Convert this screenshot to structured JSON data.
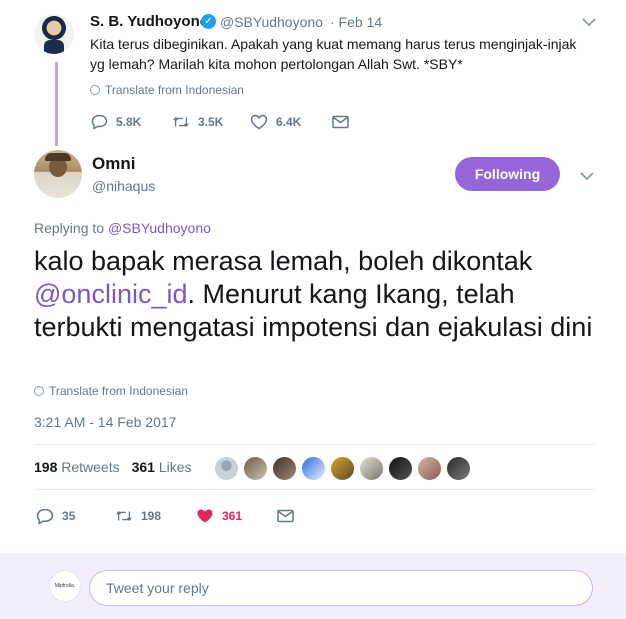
{
  "parent_tweet": {
    "name": "S. B. Yudhoyono",
    "handle": "@SBYudhoyono",
    "date": "· Feb 14",
    "text": "Kita terus dibeginikan. Apakah yang kuat memang harus terus menginjak-injak yg lemah? Marilah kita mohon pertolongan Allah Swt. *SBY*",
    "translate": "Translate from Indonesian",
    "replies": "5.8K",
    "retweets": "3.5K",
    "likes": "6.4K"
  },
  "main_tweet": {
    "name": "Omni",
    "handle": "@nihaqus",
    "follow_label": "Following",
    "replying_prefix": "Replying to",
    "replying_to": "@SBYudhoyono",
    "text_part1": "kalo bapak merasa lemah, boleh dikontak ",
    "mention": "@onclinic_id",
    "text_part2": ". Menurut kang Ikang, telah terbukti mengatasi impotensi dan ejakulasi dini",
    "translate": "Translate from Indonesian",
    "timestamp": "3:21 AM - 14 Feb 2017",
    "retweet_count": "198",
    "retweet_label": "Retweets",
    "like_count": "361",
    "like_label": "Likes",
    "reply_count": "35",
    "retweet_action_count": "198",
    "like_action_count": "361"
  },
  "reply_box": {
    "placeholder": "Tweet your reply",
    "avatar_text": "Mipfrolla."
  },
  "colors": {
    "accent": "#9566d9",
    "like": "#e0245e",
    "link": "#7e57c2"
  }
}
